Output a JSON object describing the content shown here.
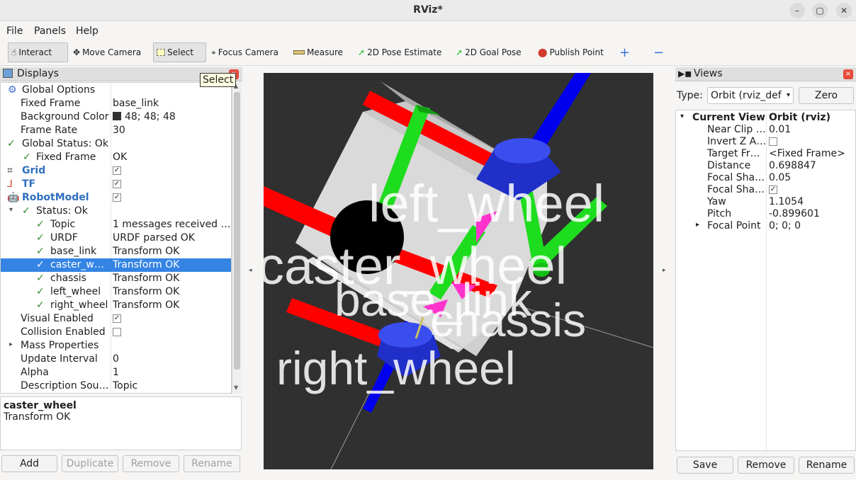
{
  "window": {
    "title": "RViz*"
  },
  "menu": {
    "file": "File",
    "panels": "Panels",
    "help": "Help"
  },
  "toolbar": {
    "interact": "Interact",
    "move_camera": "Move Camera",
    "select": "Select",
    "focus_camera": "Focus Camera",
    "measure": "Measure",
    "pose_estimate": "2D Pose Estimate",
    "goal_pose": "2D Goal Pose",
    "publish_point": "Publish Point",
    "add_icon": "plus-icon",
    "remove_icon": "minus-icon"
  },
  "tooltip": "Select",
  "displays": {
    "title": "Displays",
    "rows": [
      {
        "name": "Global Options",
        "value": ""
      },
      {
        "name": "Fixed Frame",
        "value": "base_link"
      },
      {
        "name": "Background Color",
        "value": "48; 48; 48"
      },
      {
        "name": "Frame Rate",
        "value": "30"
      },
      {
        "name": "Global Status: Ok",
        "value": ""
      },
      {
        "name": "Fixed Frame",
        "value": "OK"
      },
      {
        "name": "Grid",
        "value": "checked"
      },
      {
        "name": "TF",
        "value": "checked"
      },
      {
        "name": "RobotModel",
        "value": "checked"
      },
      {
        "name": "Status: Ok",
        "value": ""
      },
      {
        "name": "Topic",
        "value": "1 messages received …"
      },
      {
        "name": "URDF",
        "value": "URDF parsed OK"
      },
      {
        "name": "base_link",
        "value": "Transform OK"
      },
      {
        "name": "caster_w…",
        "value": "Transform OK"
      },
      {
        "name": "chassis",
        "value": "Transform OK"
      },
      {
        "name": "left_wheel",
        "value": "Transform OK"
      },
      {
        "name": "right_wheel",
        "value": "Transform OK"
      },
      {
        "name": "Visual Enabled",
        "value": "checked"
      },
      {
        "name": "Collision Enabled",
        "value": "unchecked"
      },
      {
        "name": "Mass Properties",
        "value": ""
      },
      {
        "name": "Update Interval",
        "value": "0"
      },
      {
        "name": "Alpha",
        "value": "1"
      },
      {
        "name": "Description Sou…",
        "value": "Topic"
      }
    ],
    "background_color_hex": "#303030",
    "description": {
      "title": "caster_wheel",
      "text": "Transform OK"
    },
    "buttons": {
      "add": "Add",
      "duplicate": "Duplicate",
      "remove": "Remove",
      "rename": "Rename"
    }
  },
  "viewport": {
    "labels": {
      "left_wheel": "left_wheel",
      "caster_wheel": "caster_wheel",
      "base_link": "base_link",
      "chassis": "chassis",
      "right_wheel": "right_wheel"
    },
    "colors": {
      "background": "#303030",
      "chassis": "#d9d9d9",
      "x_axis": "#ff0000",
      "y_axis": "#00c800",
      "z_axis": "#0000ff",
      "wheel": "#2a3be0",
      "caster": "#000000",
      "tf_arrow": "#ff33cc"
    }
  },
  "views": {
    "title": "Views",
    "type_label": "Type:",
    "type_value": "Orbit (rviz_def",
    "zero": "Zero",
    "current_view": {
      "name": "Current View",
      "value": "Orbit (rviz)"
    },
    "props": [
      {
        "name": "Near Clip …",
        "value": "0.01"
      },
      {
        "name": "Invert Z A…",
        "value": "unchecked"
      },
      {
        "name": "Target Fr…",
        "value": "<Fixed Frame>"
      },
      {
        "name": "Distance",
        "value": "0.698847"
      },
      {
        "name": "Focal Sha…",
        "value": "0.05"
      },
      {
        "name": "Focal Sha…",
        "value": "checked"
      },
      {
        "name": "Yaw",
        "value": "1.1054"
      },
      {
        "name": "Pitch",
        "value": "-0.899601"
      },
      {
        "name": "Focal Point",
        "value": "0; 0; 0"
      }
    ],
    "buttons": {
      "save": "Save",
      "remove": "Remove",
      "rename": "Rename"
    }
  }
}
